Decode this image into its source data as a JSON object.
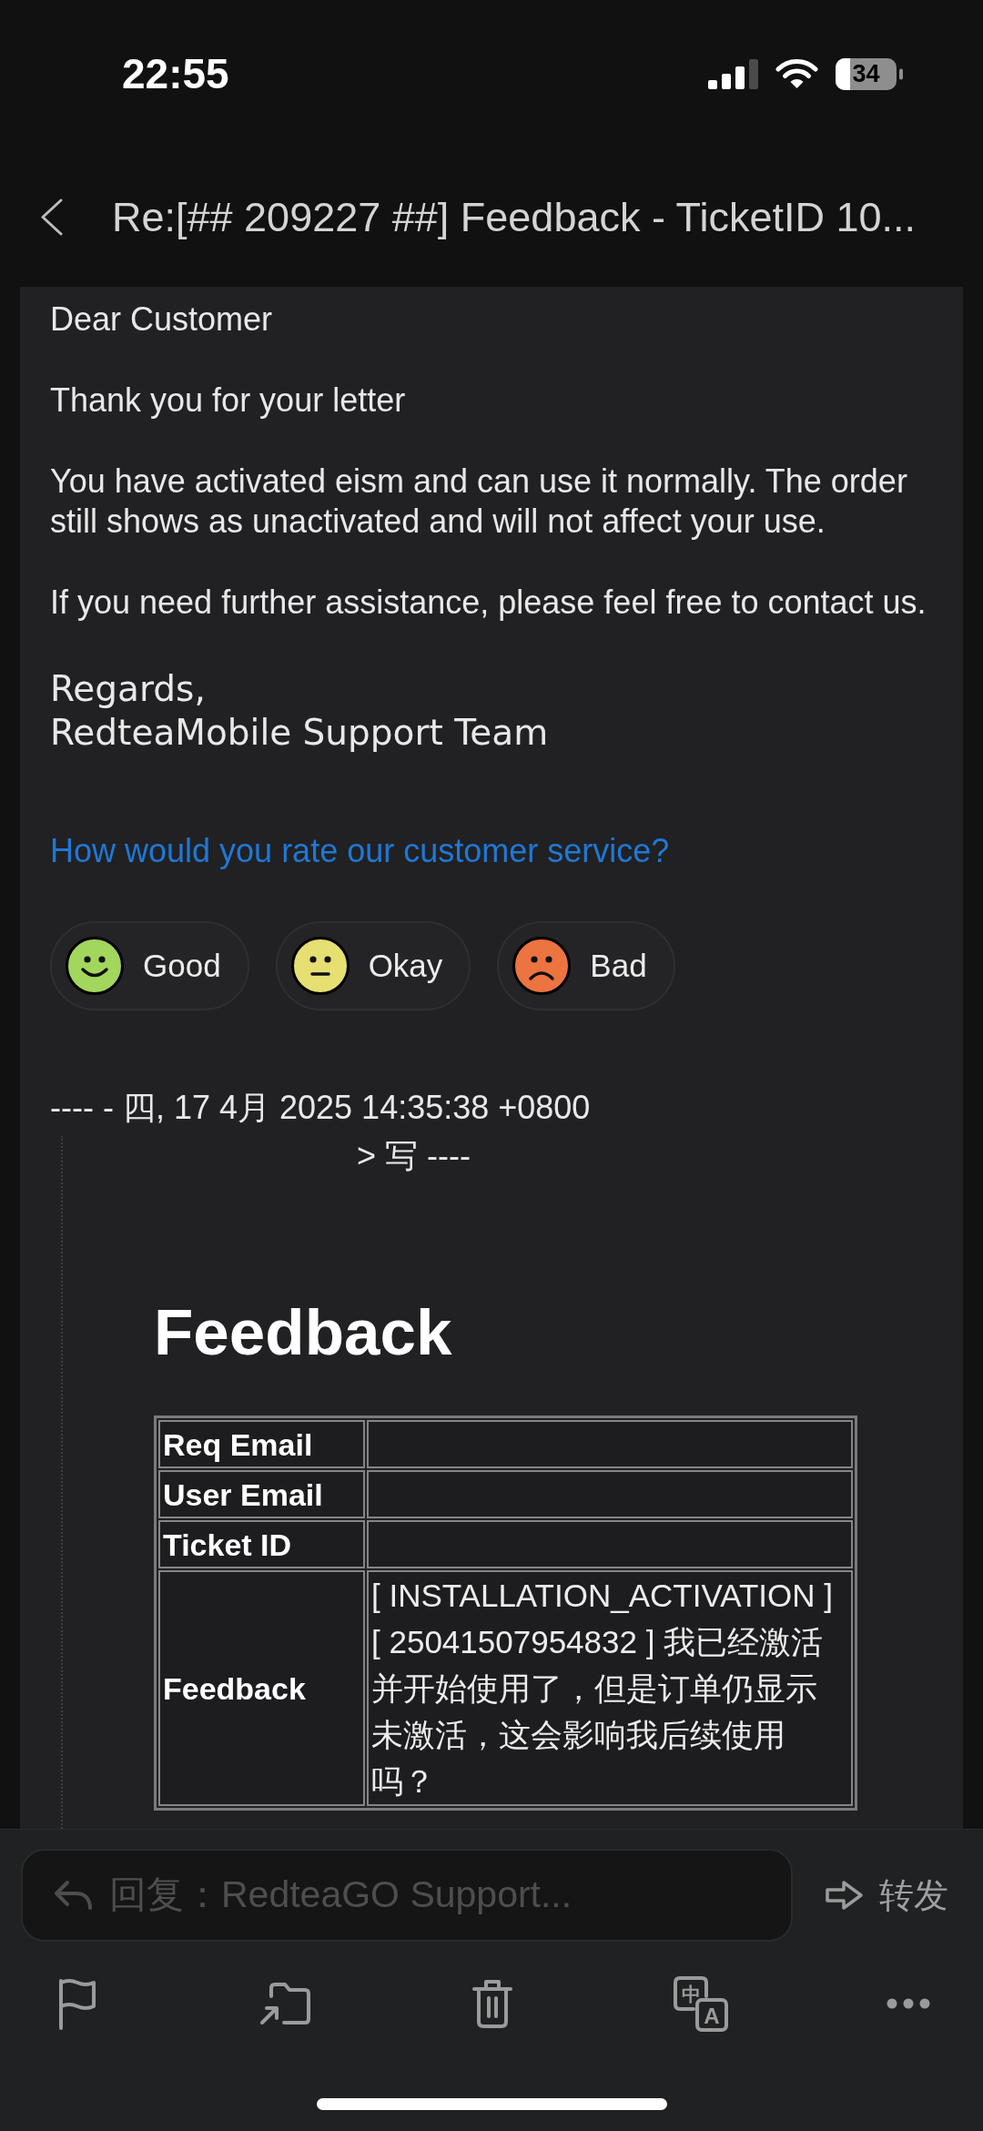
{
  "status_bar": {
    "time": "22:55",
    "battery": "34"
  },
  "header": {
    "title": "Re:[## 209227 ##] Feedback - TicketID 10..."
  },
  "email": {
    "paragraphs": [
      "Dear Customer",
      "Thank you for your letter",
      "You have activated eism and can use it normally. The order still shows as unactivated and will not affect your use.",
      "If you need further assistance, please feel free to contact us."
    ],
    "signature": [
      "Regards,",
      "RedteaMobile Support Team"
    ],
    "rating": {
      "prompt": "How would you rate our customer service?",
      "options": [
        {
          "label": "Good",
          "kind": "happy",
          "color": "#a3d65c"
        },
        {
          "label": "Okay",
          "kind": "neutral",
          "color": "#e6df72"
        },
        {
          "label": "Bad",
          "kind": "sad",
          "color": "#ec7440"
        }
      ]
    },
    "quote_header": [
      "---- - 四, 17 4月 2025 14:35:38 +0800",
      "> 写 ----"
    ],
    "quoted": {
      "title": "Feedback",
      "rows": [
        {
          "label": "Req Email"
        },
        {
          "label": "User Email"
        },
        {
          "label": "Ticket ID"
        },
        {
          "label": "Feedback",
          "value": "[ INSTALLATION_ACTIVATION ] [ 25041507954832 ] 我已经激活并开始使用了，但是订单仍显示未激活，这会影响我后续使用吗？"
        }
      ]
    }
  },
  "reply_bar": {
    "placeholder": "回复：RedteaGO Support...",
    "forward": "转发"
  },
  "toolbar": [
    {
      "kind": "flag"
    },
    {
      "kind": "move"
    },
    {
      "kind": "trash"
    },
    {
      "kind": "translate",
      "glyphs": [
        "中",
        "A"
      ]
    },
    {
      "kind": "more"
    }
  ]
}
